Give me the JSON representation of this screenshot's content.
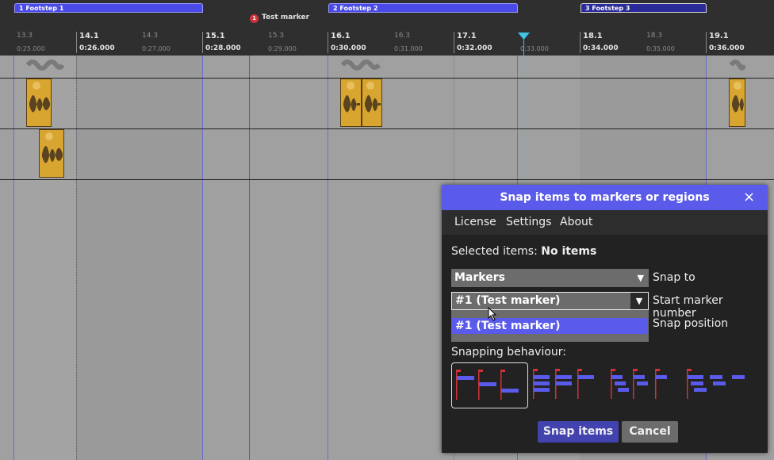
{
  "regions": [
    {
      "label": "1  Footstep 1"
    },
    {
      "label": "2  Footstep 2"
    },
    {
      "label": "3  Footstep 3"
    }
  ],
  "marker": {
    "number": "1",
    "name": "Test marker"
  },
  "ruler": {
    "major": [
      {
        "beat": "14.1",
        "time": "0:26.000"
      },
      {
        "beat": "15.1",
        "time": "0:28.000"
      },
      {
        "beat": "16.1",
        "time": "0:30.000"
      },
      {
        "beat": "17.1",
        "time": "0:32.000"
      },
      {
        "beat": "18.1",
        "time": "0:34.000"
      },
      {
        "beat": "19.1",
        "time": "0:36.000"
      }
    ],
    "minor": [
      {
        "beat": "13.3",
        "time": "0:25.000"
      },
      {
        "beat": "14.3",
        "time": "0:27.000"
      },
      {
        "beat": "15.3",
        "time": "0:29.000"
      },
      {
        "beat": "16.3",
        "time": "0:31.000"
      },
      {
        "beat": "",
        "time": "0:33.000"
      },
      {
        "beat": "18.3",
        "time": "0:35.000"
      }
    ]
  },
  "colors": {
    "accent": "#5a5aeb",
    "marker": "#d0323a",
    "item": "#d8a530",
    "playhead": "#41c3e8"
  },
  "dialog": {
    "title": "Snap items to markers or regions",
    "close": "×",
    "menu": [
      "License",
      "Settings",
      "About"
    ],
    "selected_prefix": "Selected items:",
    "selected_value": "No items",
    "snap_to": {
      "value": "Markers",
      "label": "Snap to"
    },
    "start_marker": {
      "value": "#1 (Test marker)",
      "label": "Start marker number"
    },
    "dropdown_option": "#1 (Test marker)",
    "snap_position_label": "Snap position",
    "snapping_behaviour_label": "Snapping behaviour:",
    "behaviours": [
      "behaviour-1",
      "behaviour-2",
      "behaviour-3",
      "behaviour-4"
    ],
    "snap_button": "Snap items",
    "cancel_button": "Cancel"
  }
}
